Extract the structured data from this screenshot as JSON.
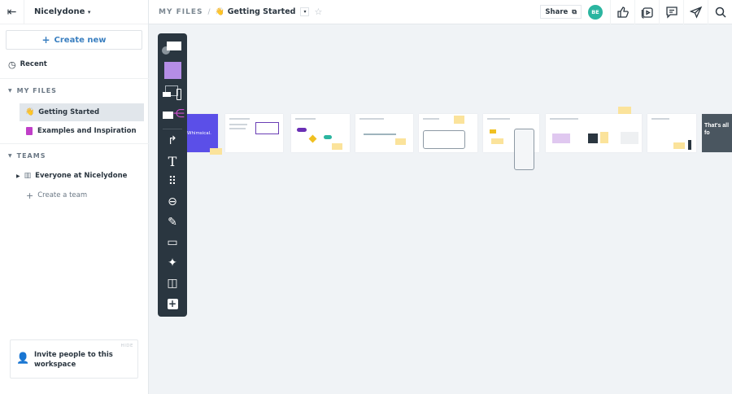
{
  "sidebar": {
    "workspace": "Nicelydone",
    "create_new": "Create new",
    "recent": "Recent",
    "my_files_label": "MY FILES",
    "files": [
      {
        "emoji": "👋",
        "label": "Getting Started"
      },
      {
        "label": "Examples and Inspiration"
      }
    ],
    "teams_label": "TEAMS",
    "team": "Everyone at Nicelydone",
    "create_team": "Create a team",
    "invite": {
      "text": "Invite people to this workspace",
      "hide": "HIDE"
    }
  },
  "header": {
    "breadcrumb_root": "MY FILES",
    "separator": "/",
    "emoji": "👋",
    "title": "Getting Started",
    "share": "Share",
    "avatar": "BE"
  },
  "canvas": {
    "board1_text": "Whimsical.",
    "last_board_text": "That's all fo"
  },
  "colors": {
    "accent": "#3a7fc0",
    "avatar": "#2bb5a0",
    "toolbar": "#2a3640",
    "purple": "#5b4fe8"
  }
}
